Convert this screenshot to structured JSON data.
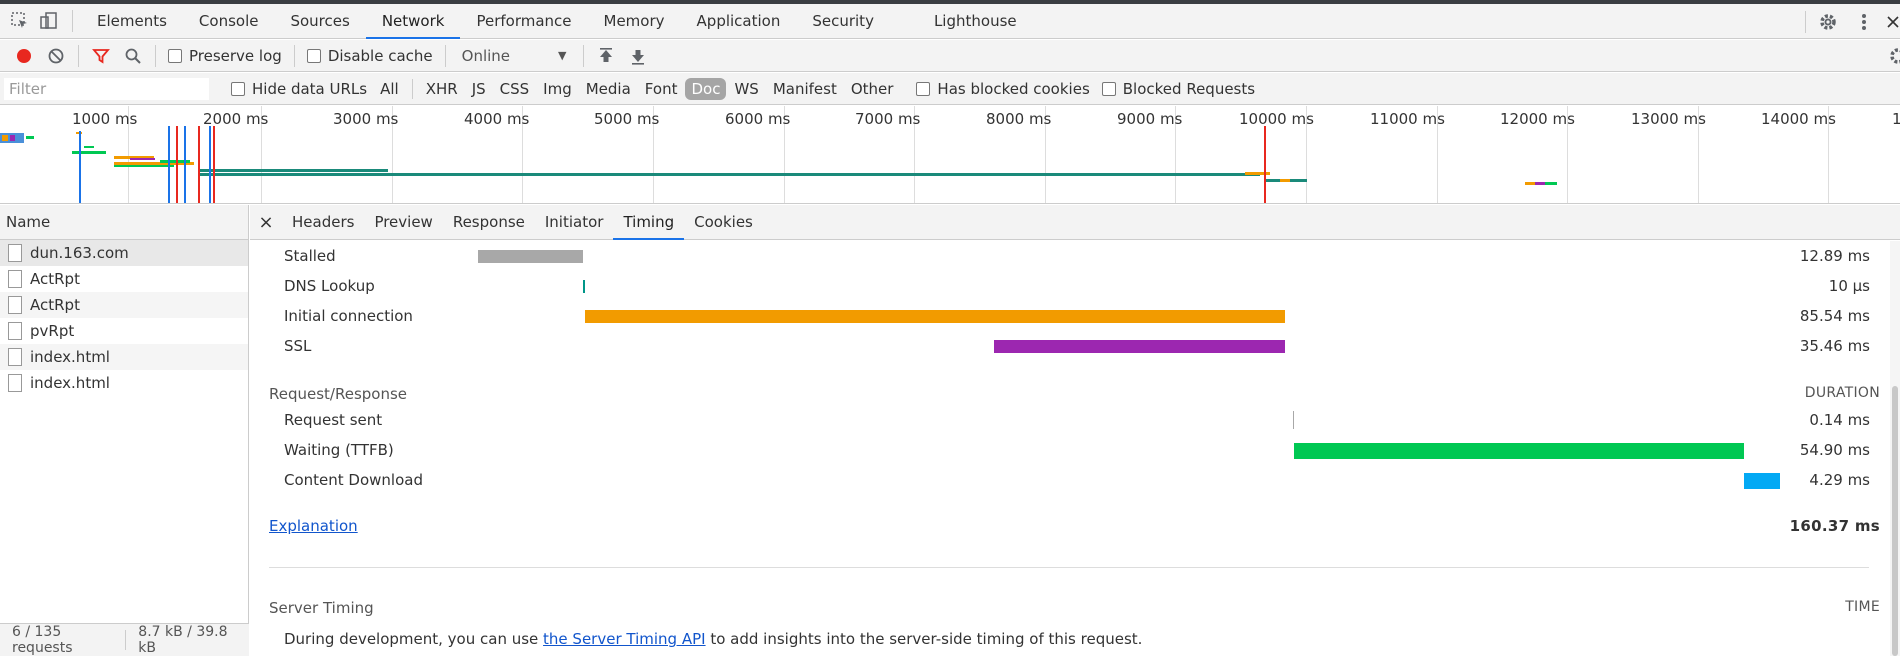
{
  "main_tabs": [
    "Elements",
    "Console",
    "Sources",
    "Network",
    "Performance",
    "Memory",
    "Application",
    "Security",
    "Lighthouse"
  ],
  "active_main_tab": "Network",
  "toolbar": {
    "preserve_log": "Preserve log",
    "disable_cache": "Disable cache",
    "throttling": "Online"
  },
  "filter": {
    "placeholder": "Filter",
    "hide_data_urls": "Hide data URLs",
    "types": [
      "All",
      "XHR",
      "JS",
      "CSS",
      "Img",
      "Media",
      "Font",
      "Doc",
      "WS",
      "Manifest",
      "Other"
    ],
    "active_type": "Doc",
    "has_blocked_cookies": "Has blocked cookies",
    "blocked_requests": "Blocked Requests"
  },
  "overview": {
    "ticks": [
      "1000 ms",
      "2000 ms",
      "3000 ms",
      "4000 ms",
      "5000 ms",
      "6000 ms",
      "7000 ms",
      "8000 ms",
      "9000 ms",
      "10000 ms",
      "11000 ms",
      "12000 ms",
      "13000 ms",
      "14000 ms",
      "1"
    ]
  },
  "request_list": {
    "header": "Name",
    "rows": [
      "dun.163.com",
      "ActRpt",
      "ActRpt",
      "pvRpt",
      "index.html",
      "index.html"
    ],
    "footer_requests": "6 / 135 requests",
    "footer_size": "8.7 kB / 39.8 kB"
  },
  "detail_tabs": [
    "Headers",
    "Preview",
    "Response",
    "Initiator",
    "Timing",
    "Cookies"
  ],
  "active_detail_tab": "Timing",
  "timing": {
    "connection_rows": [
      {
        "label": "Stalled",
        "value": "12.89 ms",
        "color": "#a8a8a8"
      },
      {
        "label": "DNS Lookup",
        "value": "10 µs",
        "color": "#009688"
      },
      {
        "label": "Initial connection",
        "value": "85.54 ms",
        "color": "#f29b00"
      },
      {
        "label": "SSL",
        "value": "35.46 ms",
        "color": "#9c27b0"
      }
    ],
    "request_section": "Request/Response",
    "duration_header": "DURATION",
    "request_rows": [
      {
        "label": "Request sent",
        "value": "0.14 ms",
        "color": "#a8a8a8"
      },
      {
        "label": "Waiting (TTFB)",
        "value": "54.90 ms",
        "color": "#00c853"
      },
      {
        "label": "Content Download",
        "value": "4.29 ms",
        "color": "#03a9f4"
      }
    ],
    "explanation": "Explanation",
    "total": "160.37 ms",
    "server_timing": "Server Timing",
    "time_header": "TIME",
    "server_text_before": "During development, you can use ",
    "server_link": "the Server Timing API",
    "server_text_after": " to add insights into the server-side timing of this request."
  }
}
